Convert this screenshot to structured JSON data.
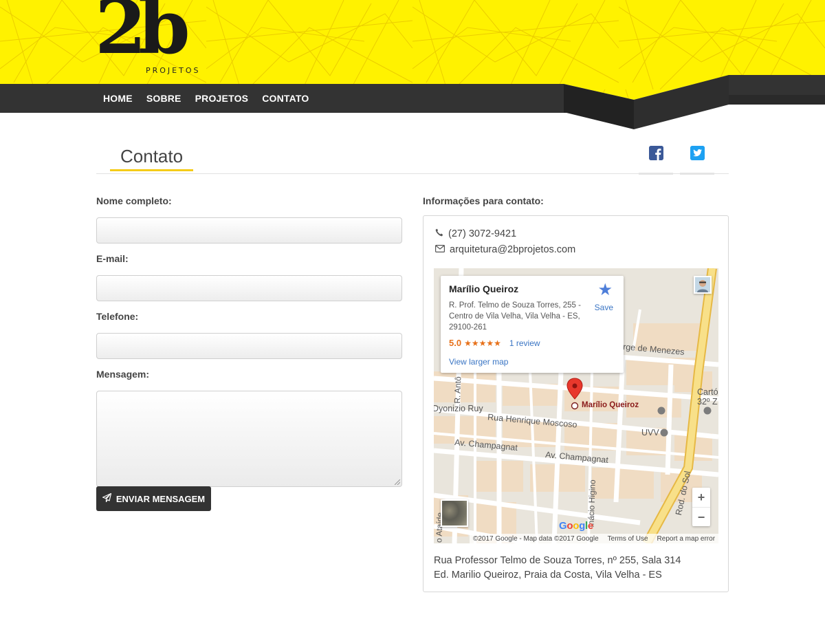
{
  "brand": {
    "logo_mark": "2b",
    "logo_sub": "PROJETOS"
  },
  "nav": {
    "items": [
      "HOME",
      "SOBRE",
      "PROJETOS",
      "CONTATO"
    ]
  },
  "page": {
    "title": "Contato"
  },
  "social": {
    "facebook_icon": "facebook-icon",
    "twitter_icon": "twitter-icon"
  },
  "form": {
    "name_label": "Nome completo:",
    "email_label": "E-mail:",
    "phone_label": "Telefone:",
    "message_label": "Mensagem:",
    "name_value": "",
    "email_value": "",
    "phone_value": "",
    "message_value": "",
    "submit_label": "ENVIAR MENSAGEM",
    "submit_icon": "paper-plane-icon"
  },
  "contact": {
    "heading": "Informações para contato:",
    "phone": "(27) 3072-9421",
    "email": "arquitetura@2bprojetos.com",
    "address_line1": "Rua Professor Telmo de Souza Torres, nº 255, Sala 314",
    "address_line2": "Ed. Marilio Queiroz, Praia da Costa, Vila Velha - ES"
  },
  "map": {
    "place_name": "Marílio Queiroz",
    "place_address": "R. Prof. Telmo de Souza Torres, 255 - Centro de Vila Velha, Vila Velha - ES, 29100-261",
    "rating": "5.0",
    "stars": "★★★★★",
    "reviews": "1 review",
    "larger_map": "View larger map",
    "save": "Save",
    "poi_label": "Marílio Queiroz",
    "streets": {
      "henrique": "Rua Henrique Moscoso",
      "champagnat1": "Av. Champagnat",
      "champagnat2": "Av. Champagnat",
      "dyonizio": "Dyonizio Ruy",
      "jorge": "rge de Menezes",
      "rodsol": "Rod. do Sol",
      "inacio": "Inácio Higino",
      "ataide": "o Ataíde",
      "rant": "R. Antô",
      "uvv": "UVV",
      "carto1": "Cartó",
      "carto2": "32º Z"
    },
    "google": "Google",
    "footer": {
      "copyright": "©2017 Google - Map data ©2017 Google",
      "terms": "Terms of Use",
      "report": "Report a map error"
    },
    "zoom_in": "+",
    "zoom_out": "−"
  }
}
